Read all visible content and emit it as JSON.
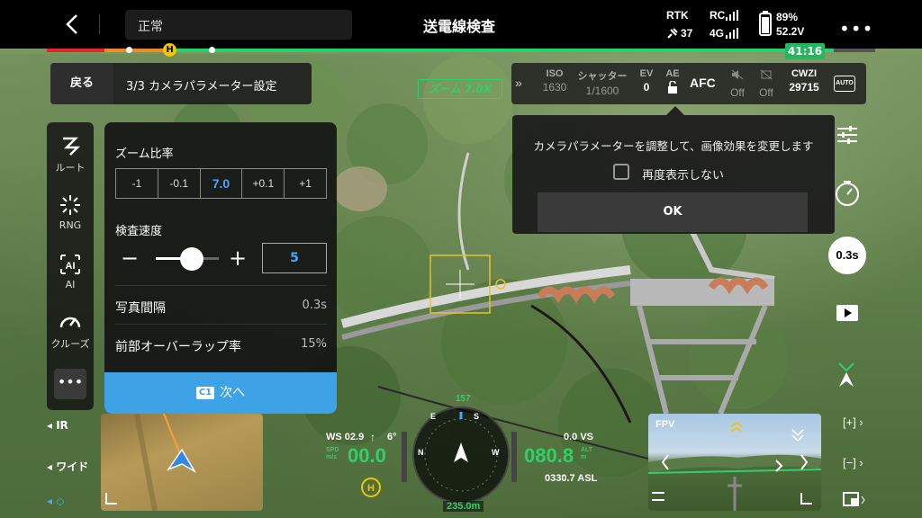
{
  "topbar": {
    "status_text": "正常",
    "title": "送電線検査",
    "rtk_label": "RTK",
    "rtk_sats": "37",
    "rc_label": "RC",
    "rc_net": "4G",
    "battery_pct": "89%",
    "battery_voltage": "52.2V",
    "timer": "41:16",
    "home_badge": "H"
  },
  "step": {
    "back_label": "戻る",
    "text": "3/3 カメラパラメーター設定"
  },
  "zoom_indicator": "ズーム 7.0X",
  "camera": {
    "expand": "»",
    "iso_label": "ISO",
    "iso_value": "1630",
    "shutter_label": "シャッター",
    "shutter_value": "1/1600",
    "ev_label": "EV",
    "ev_value": "0",
    "ae_label": "AE",
    "af_mode": "AFC",
    "off1": "Off",
    "off2": "Off",
    "storage_label": "CWZI",
    "storage_value": "29715",
    "auto_badge": "AUTO"
  },
  "sidebar": {
    "items": [
      {
        "label": "ルート",
        "icon": "route-icon"
      },
      {
        "label": "RNG",
        "icon": "rng-icon"
      },
      {
        "label": "AI",
        "icon": "ai-icon"
      },
      {
        "label": "クルーズ",
        "icon": "cruise-icon"
      }
    ],
    "more": "•••"
  },
  "panel": {
    "zoom_title": "ズーム比率",
    "zoom_options": [
      "-1",
      "-0.1",
      "7.0",
      "+0.1",
      "+1"
    ],
    "speed_title": "検査速度",
    "speed_value": "5",
    "speed_level": 0.45,
    "photo_interval_label": "写真間隔",
    "photo_interval_value": "0.3s",
    "overlap_label": "前部オーバーラップ率",
    "overlap_value": "15%",
    "next_badge": "C1",
    "next_label": "次へ"
  },
  "tip": {
    "message": "カメラパラメーターを調整して、画像効果を変更します",
    "checkbox_label": "再度表示しない",
    "ok_label": "OK"
  },
  "right_rail": {
    "shutter_value": "0.3s"
  },
  "bottom_left": {
    "ir_label": "IR",
    "wide_label": "ワイド"
  },
  "telemetry": {
    "ws_label": "WS 02.9",
    "ws_dir": "6°",
    "speed_unit_top": "SPD",
    "speed_unit_bottom": "m/s",
    "speed_value": "00.0",
    "heading": "157",
    "vs_label": "0.0 VS",
    "alt_value": "080.8",
    "alt_unit_top": "ALT",
    "alt_unit_bottom": "m",
    "asl": "0330.7 ASL",
    "distance": "235.0m",
    "compass_n": "N",
    "compass_e": "E",
    "compass_s": "S",
    "compass_w": "W"
  },
  "fpv": {
    "label": "FPV"
  }
}
